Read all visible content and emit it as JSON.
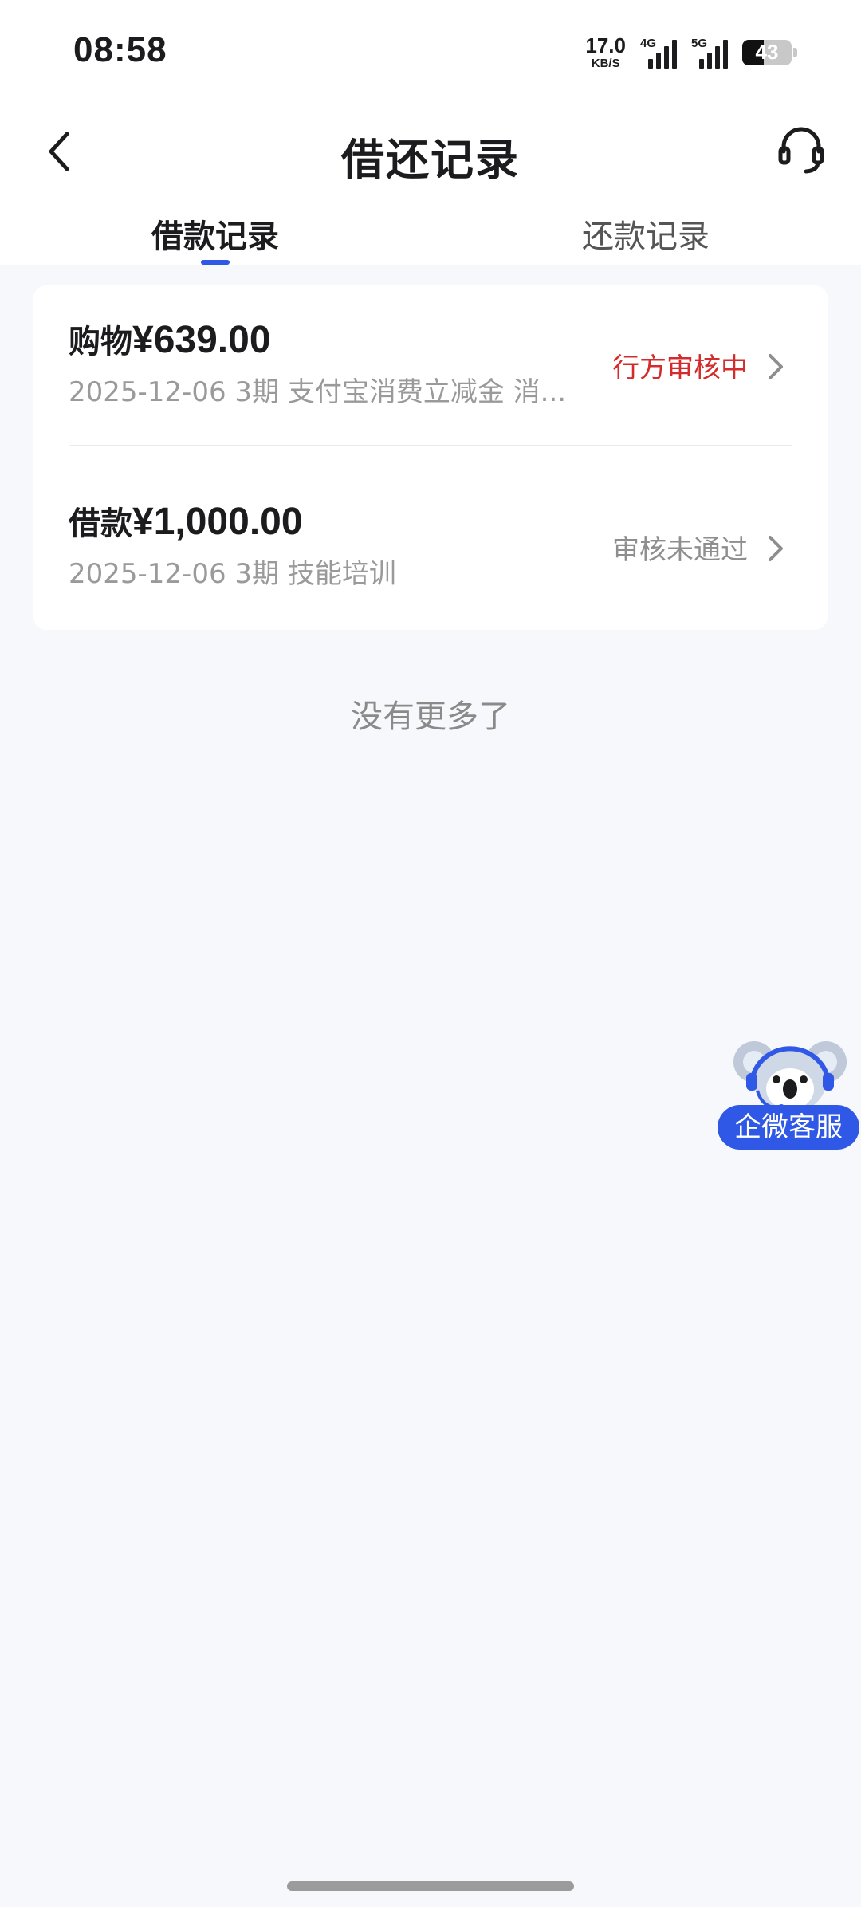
{
  "status_bar": {
    "time": "08:58",
    "net_speed_value": "17.0",
    "net_speed_unit": "KB/S",
    "signal_1_label": "4G",
    "signal_2_label": "5G",
    "battery_level": "43"
  },
  "header": {
    "title": "借还记录",
    "back_icon": "chevron-left-icon",
    "service_icon": "headset-icon"
  },
  "tabs": [
    {
      "label": "借款记录",
      "active": true
    },
    {
      "label": "还款记录",
      "active": false
    }
  ],
  "records": [
    {
      "label": "购物",
      "amount": "¥639.00",
      "meta": "2025-12-06 3期  支付宝消费立减金 消...",
      "status": "行方审核中",
      "status_color": "#D42C2C"
    },
    {
      "label": "借款",
      "amount": "¥1,000.00",
      "meta": "2025-12-06 3期  技能培训",
      "status": "审核未通过",
      "status_color": "#8E8E8E"
    }
  ],
  "footer_text": "没有更多了",
  "floating_service": {
    "label": "企微客服",
    "icon": "koala-mascot-icon"
  },
  "colors": {
    "accent": "#2F58E6",
    "background": "#F7F8FC",
    "status_pending": "#D42C2C",
    "status_rejected": "#8E8E8E"
  }
}
